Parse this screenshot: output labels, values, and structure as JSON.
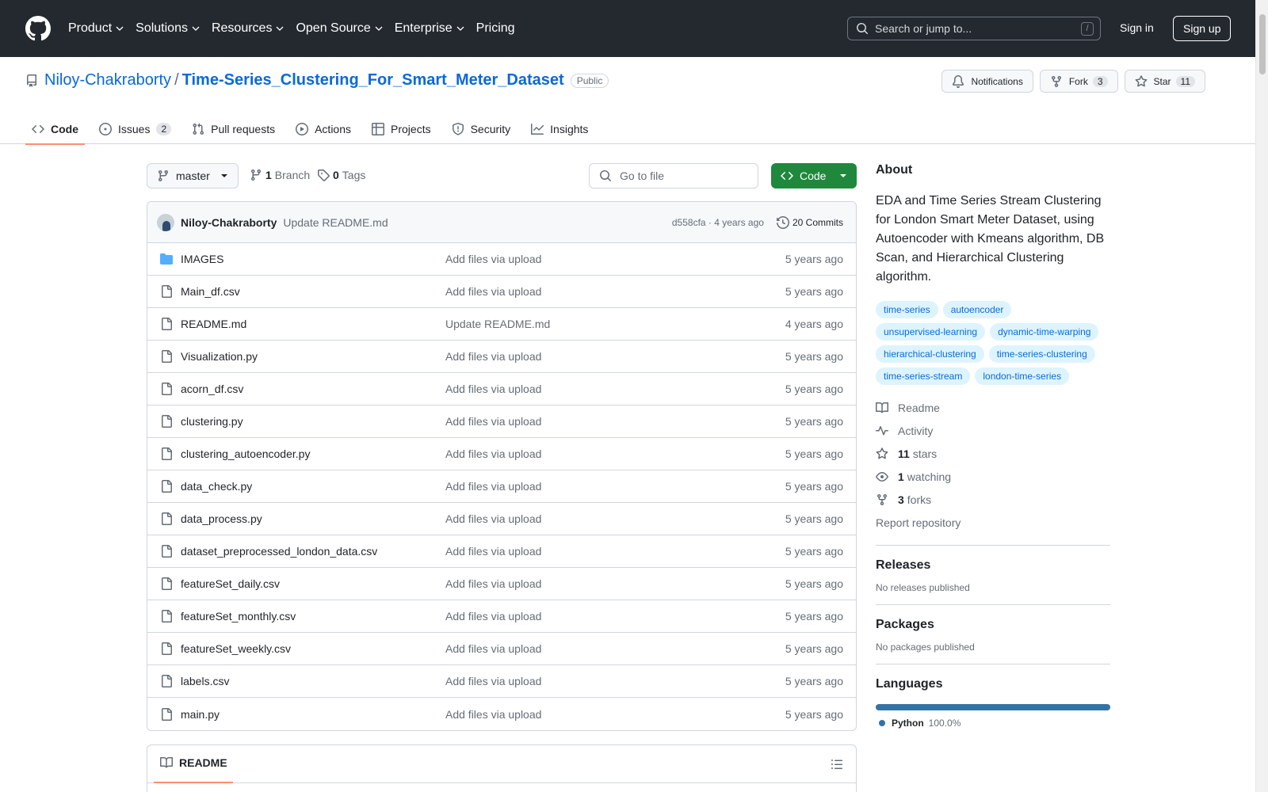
{
  "header": {
    "nav": [
      {
        "label": "Product",
        "dropdown": true
      },
      {
        "label": "Solutions",
        "dropdown": true
      },
      {
        "label": "Resources",
        "dropdown": true
      },
      {
        "label": "Open Source",
        "dropdown": true
      },
      {
        "label": "Enterprise",
        "dropdown": true
      },
      {
        "label": "Pricing",
        "dropdown": false
      }
    ],
    "search_placeholder": "Search or jump to...",
    "search_key": "/",
    "signin": "Sign in",
    "signup": "Sign up"
  },
  "repo": {
    "owner": "Niloy-Chakraborty",
    "separator": "/",
    "name": "Time-Series_Clustering_For_Smart_Meter_Dataset",
    "visibility": "Public",
    "notifications_label": "Notifications",
    "fork_label": "Fork",
    "fork_count": "3",
    "star_label": "Star",
    "star_count": "11"
  },
  "tabs": [
    {
      "label": "Code",
      "icon": "code-icon",
      "active": true,
      "count": ""
    },
    {
      "label": "Issues",
      "icon": "issue-icon",
      "active": false,
      "count": "2"
    },
    {
      "label": "Pull requests",
      "icon": "pull-request-icon",
      "active": false,
      "count": ""
    },
    {
      "label": "Actions",
      "icon": "play-icon",
      "active": false,
      "count": ""
    },
    {
      "label": "Projects",
      "icon": "table-icon",
      "active": false,
      "count": ""
    },
    {
      "label": "Security",
      "icon": "shield-icon",
      "active": false,
      "count": ""
    },
    {
      "label": "Insights",
      "icon": "graph-icon",
      "active": false,
      "count": ""
    }
  ],
  "toolbar": {
    "branch": "master",
    "branch_count": "1",
    "branch_label": "Branch",
    "tag_count": "0",
    "tag_label": "Tags",
    "goto_placeholder": "Go to file",
    "code_button": "Code"
  },
  "commit": {
    "author": "Niloy-Chakraborty",
    "message": "Update README.md",
    "meta": "d558cfa · 4 years ago",
    "commits_count": "20",
    "commits_label": "Commits"
  },
  "files": [
    {
      "name": "IMAGES",
      "type": "dir",
      "message": "Add files via upload",
      "age": "5 years ago"
    },
    {
      "name": "Main_df.csv",
      "type": "file",
      "message": "Add files via upload",
      "age": "5 years ago"
    },
    {
      "name": "README.md",
      "type": "file",
      "message": "Update README.md",
      "age": "4 years ago"
    },
    {
      "name": "Visualization.py",
      "type": "file",
      "message": "Add files via upload",
      "age": "5 years ago"
    },
    {
      "name": "acorn_df.csv",
      "type": "file",
      "message": "Add files via upload",
      "age": "5 years ago"
    },
    {
      "name": "clustering.py",
      "type": "file",
      "message": "Add files via upload",
      "age": "5 years ago"
    },
    {
      "name": "clustering_autoencoder.py",
      "type": "file",
      "message": "Add files via upload",
      "age": "5 years ago"
    },
    {
      "name": "data_check.py",
      "type": "file",
      "message": "Add files via upload",
      "age": "5 years ago"
    },
    {
      "name": "data_process.py",
      "type": "file",
      "message": "Add files via upload",
      "age": "5 years ago"
    },
    {
      "name": "dataset_preprocessed_london_data.csv",
      "type": "file",
      "message": "Add files via upload",
      "age": "5 years ago"
    },
    {
      "name": "featureSet_daily.csv",
      "type": "file",
      "message": "Add files via upload",
      "age": "5 years ago"
    },
    {
      "name": "featureSet_monthly.csv",
      "type": "file",
      "message": "Add files via upload",
      "age": "5 years ago"
    },
    {
      "name": "featureSet_weekly.csv",
      "type": "file",
      "message": "Add files via upload",
      "age": "5 years ago"
    },
    {
      "name": "labels.csv",
      "type": "file",
      "message": "Add files via upload",
      "age": "5 years ago"
    },
    {
      "name": "main.py",
      "type": "file",
      "message": "Add files via upload",
      "age": "5 years ago"
    }
  ],
  "readme": {
    "tab_label": "README"
  },
  "about": {
    "title": "About",
    "description": "EDA and Time Series Stream Clustering for London Smart Meter Dataset, using Autoencoder with Kmeans algorithm, DB Scan, and Hierarchical Clustering algorithm.",
    "topics": [
      "time-series",
      "autoencoder",
      "unsupervised-learning",
      "dynamic-time-warping",
      "hierarchical-clustering",
      "time-series-clustering",
      "time-series-stream",
      "london-time-series"
    ],
    "links": [
      {
        "icon": "book-icon",
        "bold": "",
        "label": "Readme"
      },
      {
        "icon": "pulse-icon",
        "bold": "",
        "label": "Activity"
      },
      {
        "icon": "star-icon",
        "bold": "11",
        "label": "stars"
      },
      {
        "icon": "eye-icon",
        "bold": "1",
        "label": "watching"
      },
      {
        "icon": "fork-icon",
        "bold": "3",
        "label": "forks"
      }
    ],
    "report": "Report repository"
  },
  "releases": {
    "title": "Releases",
    "subtitle": "No releases published"
  },
  "packages": {
    "title": "Packages",
    "subtitle": "No packages published"
  },
  "languages": {
    "title": "Languages",
    "items": [
      {
        "name": "Python",
        "percent": "100.0%",
        "color": "#3572A5"
      }
    ]
  }
}
